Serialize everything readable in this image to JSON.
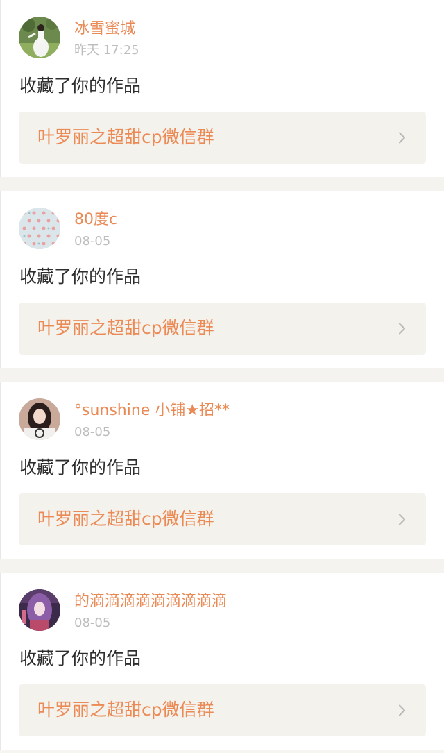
{
  "notifications": [
    {
      "username": "冰雪蜜城",
      "time": "昨天 17:25",
      "action": "收藏了你的作品",
      "work_title": "叶罗丽之超甜cp微信群",
      "avatar": "avatar-woman-in-white-dress"
    },
    {
      "username": "80度c",
      "time": "08-05",
      "action": "收藏了你的作品",
      "work_title": "叶罗丽之超甜cp微信群",
      "avatar": "avatar-polka-dot-pattern"
    },
    {
      "username": "°sunshine 小铺★招**",
      "time": "08-05",
      "action": "收藏了你的作品",
      "work_title": "叶罗丽之超甜cp微信群",
      "avatar": "avatar-dark-haired-girl"
    },
    {
      "username": "的滴滴滴滴滴滴滴滴滴",
      "time": "08-05",
      "action": "收藏了你的作品",
      "work_title": "叶罗丽之超甜cp微信群",
      "avatar": "avatar-purple-haired-anime"
    }
  ],
  "colors": {
    "username": "#e98a56",
    "work_title": "#ec8a55",
    "time": "#bdbdbd",
    "card_link_bg": "#f3f2ed"
  }
}
